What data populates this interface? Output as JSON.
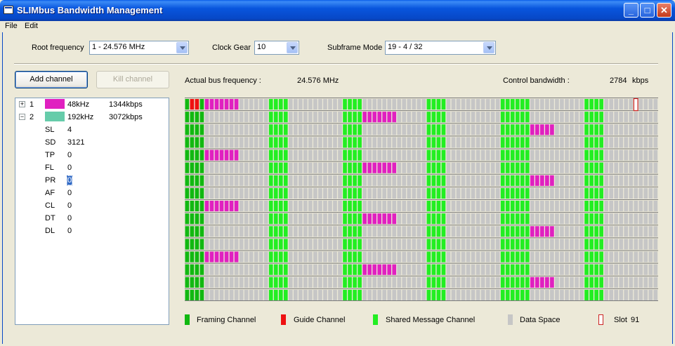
{
  "window": {
    "title": "SLIMbus Bandwidth Management",
    "minimize_glyph": "_",
    "maximize_glyph": "□",
    "close_glyph": "✕"
  },
  "menu": [
    "File",
    "Edit"
  ],
  "controls": {
    "root_frequency_label": "Root frequency",
    "root_frequency_value": "1 - 24.576 MHz",
    "clock_gear_label": "Clock Gear",
    "clock_gear_value": "10",
    "subframe_mode_label": "Subframe Mode",
    "subframe_mode_value": "19 - 4 / 32"
  },
  "buttons": {
    "add_channel": "Add channel",
    "kill_channel": "Kill channel"
  },
  "info": {
    "actual_bus_frequency_label": "Actual bus frequency :",
    "actual_bus_frequency_value": "24.576 MHz",
    "control_bandwidth_label": "Control bandwidth :",
    "control_bandwidth_value": "2784",
    "control_bandwidth_unit": "kbps"
  },
  "channels": [
    {
      "id": "1",
      "expander": "+",
      "color": "#e020c0",
      "freq": "48kHz",
      "rate": "1344kbps"
    },
    {
      "id": "2",
      "expander": "−",
      "color": "#66ccaa",
      "freq": "192kHz",
      "rate": "3072kbps"
    }
  ],
  "channel_details": [
    {
      "key": "SL",
      "value": "4"
    },
    {
      "key": "SD",
      "value": "3121"
    },
    {
      "key": "TP",
      "value": "0"
    },
    {
      "key": "FL",
      "value": "0"
    },
    {
      "key": "PR",
      "value": "0"
    },
    {
      "key": "AF",
      "value": "0"
    },
    {
      "key": "CL",
      "value": "0"
    },
    {
      "key": "DT",
      "value": "0"
    },
    {
      "key": "DL",
      "value": "0"
    }
  ],
  "slot_grid": {
    "rows": 16,
    "slots_per_row": 96,
    "colors": {
      "framing": "#11b811",
      "guide": "#ee1111",
      "shared_message": "#22ee22",
      "data_space": "#c6c6c6",
      "channel_48k": "#e020c0",
      "selected_border": "#cc2222"
    },
    "selected_slot": 91
  },
  "legend": [
    {
      "label": "Framing Channel",
      "color": "#11b811",
      "type": "fill"
    },
    {
      "label": "Guide Channel",
      "color": "#ee1111",
      "type": "fill"
    },
    {
      "label": "Shared Message Channel",
      "color": "#22ee22",
      "type": "fill"
    },
    {
      "label": "Data Space",
      "color": "#c6c6c6",
      "type": "fill"
    },
    {
      "label": "Slot",
      "value": "91",
      "color": "#cc2222",
      "type": "outline"
    }
  ]
}
